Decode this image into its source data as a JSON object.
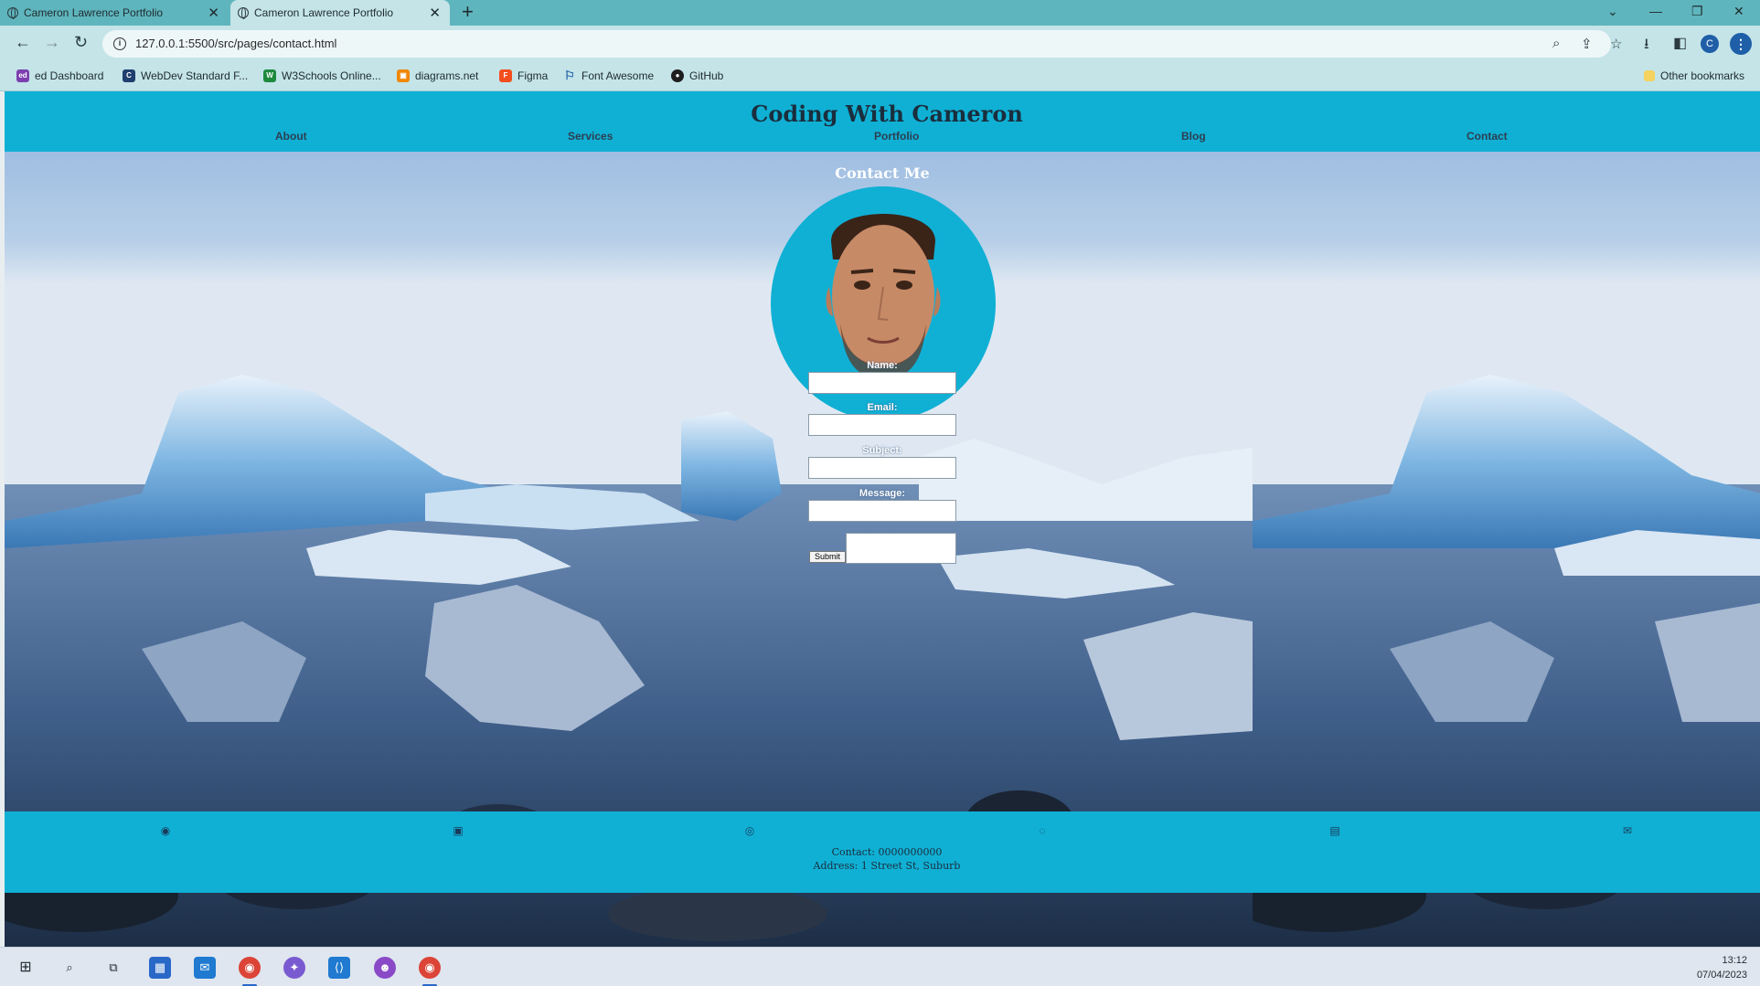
{
  "browser": {
    "tabs": [
      {
        "title": "Cameron Lawrence Portfolio",
        "active": false
      },
      {
        "title": "Cameron Lawrence Portfolio",
        "active": true
      }
    ],
    "url": "127.0.0.1:5500/src/pages/contact.html",
    "bookmarks": [
      {
        "label": "ed Dashboard",
        "icon": "ed-icon"
      },
      {
        "label": "WebDev Standard F...",
        "icon": "webdev-icon"
      },
      {
        "label": "W3Schools Online...",
        "icon": "w3schools-icon"
      },
      {
        "label": "diagrams.net",
        "icon": "diagrams-icon"
      },
      {
        "label": "Figma",
        "icon": "figma-icon"
      },
      {
        "label": "Font Awesome",
        "icon": "flag-icon"
      },
      {
        "label": "GitHub",
        "icon": "github-icon"
      }
    ],
    "other_bookmarks": "Other bookmarks",
    "profile_initial": "C"
  },
  "site": {
    "title": "Coding With Cameron",
    "nav": [
      "About",
      "Services",
      "Portfolio",
      "Blog",
      "Contact"
    ],
    "contact_heading": "Contact Me",
    "form": {
      "name_label": "Name:",
      "email_label": "Email:",
      "subject_label": "Subject:",
      "message_label": "Message:",
      "submit_label": "Submit"
    },
    "footer": {
      "socials": [
        "github-icon",
        "linkedin-icon",
        "instagram-icon",
        "messenger-icon",
        "facebook-icon",
        "envelope-icon"
      ],
      "contact": "Contact: 0000000000",
      "address": "Address: 1 Street St, Suburb"
    }
  },
  "taskbar": {
    "time": "13:12",
    "date": "07/04/2023"
  },
  "colors": {
    "accent": "#10b0d5",
    "chrome": "#c4e4e8",
    "tabbar": "#5fb5bd"
  }
}
